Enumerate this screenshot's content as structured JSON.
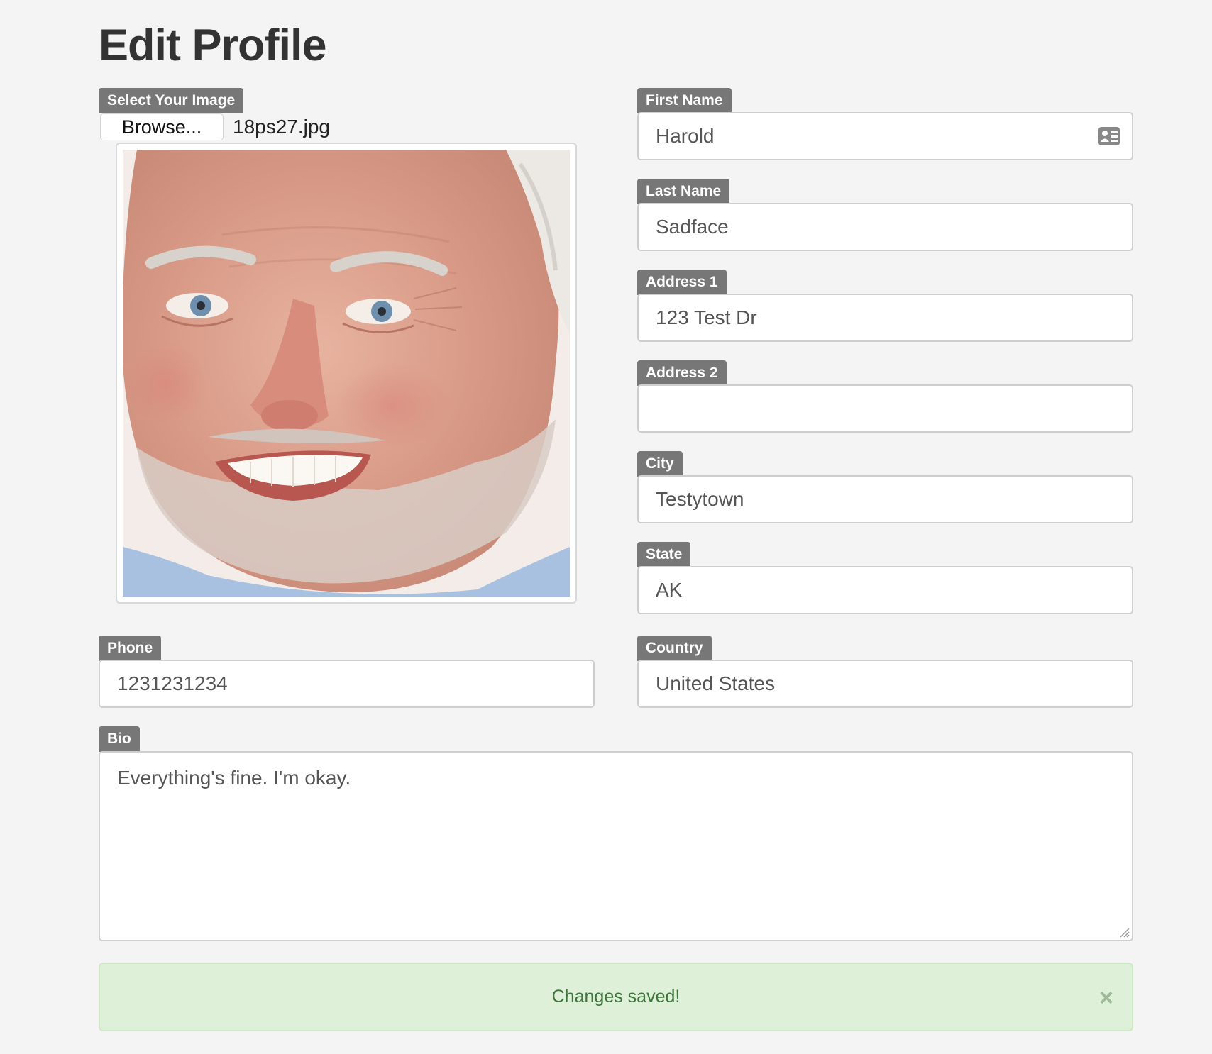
{
  "page": {
    "title": "Edit Profile"
  },
  "image": {
    "label": "Select Your Image",
    "browse_label": "Browse...",
    "file_name": "18ps27.jpg"
  },
  "fields": {
    "first_name": {
      "label": "First Name",
      "value": "Harold"
    },
    "last_name": {
      "label": "Last Name",
      "value": "Sadface"
    },
    "address1": {
      "label": "Address 1",
      "value": "123 Test Dr"
    },
    "address2": {
      "label": "Address 2",
      "value": ""
    },
    "city": {
      "label": "City",
      "value": "Testytown"
    },
    "state": {
      "label": "State",
      "value": "AK"
    },
    "phone": {
      "label": "Phone",
      "value": "1231231234"
    },
    "country": {
      "label": "Country",
      "value": "United States"
    },
    "bio": {
      "label": "Bio",
      "value": "Everything's fine. I'm okay."
    }
  },
  "alert": {
    "message": "Changes saved!",
    "close_label": "×"
  },
  "icons": {
    "contact_card": "contact-card-icon",
    "close": "close-icon",
    "resize": "resize-grip-icon"
  },
  "colors": {
    "label_bg": "#777777",
    "alert_bg": "#dff0d8",
    "alert_text": "#3c763d",
    "page_bg": "#f4f4f4"
  }
}
